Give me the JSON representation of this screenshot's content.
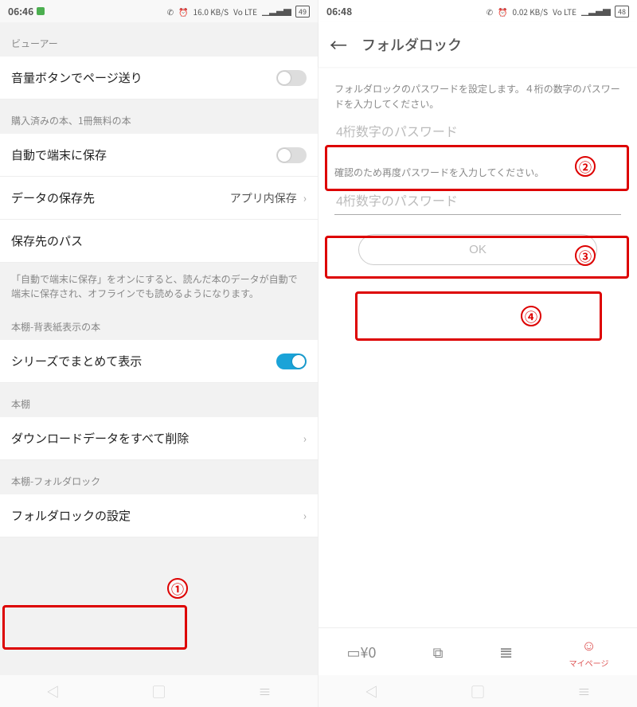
{
  "left": {
    "status": {
      "time": "06:46",
      "net": "16.0 KB/S",
      "battery": "49"
    },
    "sections": {
      "viewer": {
        "label": "ビューアー",
        "volume_paging": "音量ボタンでページ送り"
      },
      "purchased": {
        "label": "購入済みの本、1冊無料の本",
        "auto_save": "自動で端末に保存",
        "save_dest": "データの保存先",
        "save_dest_value": "アプリ内保存",
        "save_path": "保存先のパス",
        "desc": "「自動で端末に保存」をオンにすると、読んだ本のデータが自動で端末に保存され、オフラインでも読めるようになります。"
      },
      "spine": {
        "label": "本棚-背表紙表示の本",
        "series_group": "シリーズでまとめて表示"
      },
      "shelf": {
        "label": "本棚",
        "delete_all": "ダウンロードデータをすべて削除"
      },
      "lock": {
        "label": "本棚-フォルダロック",
        "setting": "フォルダロックの設定"
      }
    }
  },
  "right": {
    "status": {
      "time": "06:48",
      "net": "0.02 KB/S",
      "battery": "48"
    },
    "title": "フォルダロック",
    "helper1": "フォルダロックのパスワードを設定します。４桁の数字のパスワードを入力してください。",
    "placeholder": "4桁数字のパスワード",
    "helper2": "確認のため再度パスワードを入力してください。",
    "ok": "OK",
    "nav": {
      "mypage": "マイページ"
    }
  },
  "annotations": {
    "n1": "①",
    "n2": "②",
    "n3": "③",
    "n4": "④"
  }
}
